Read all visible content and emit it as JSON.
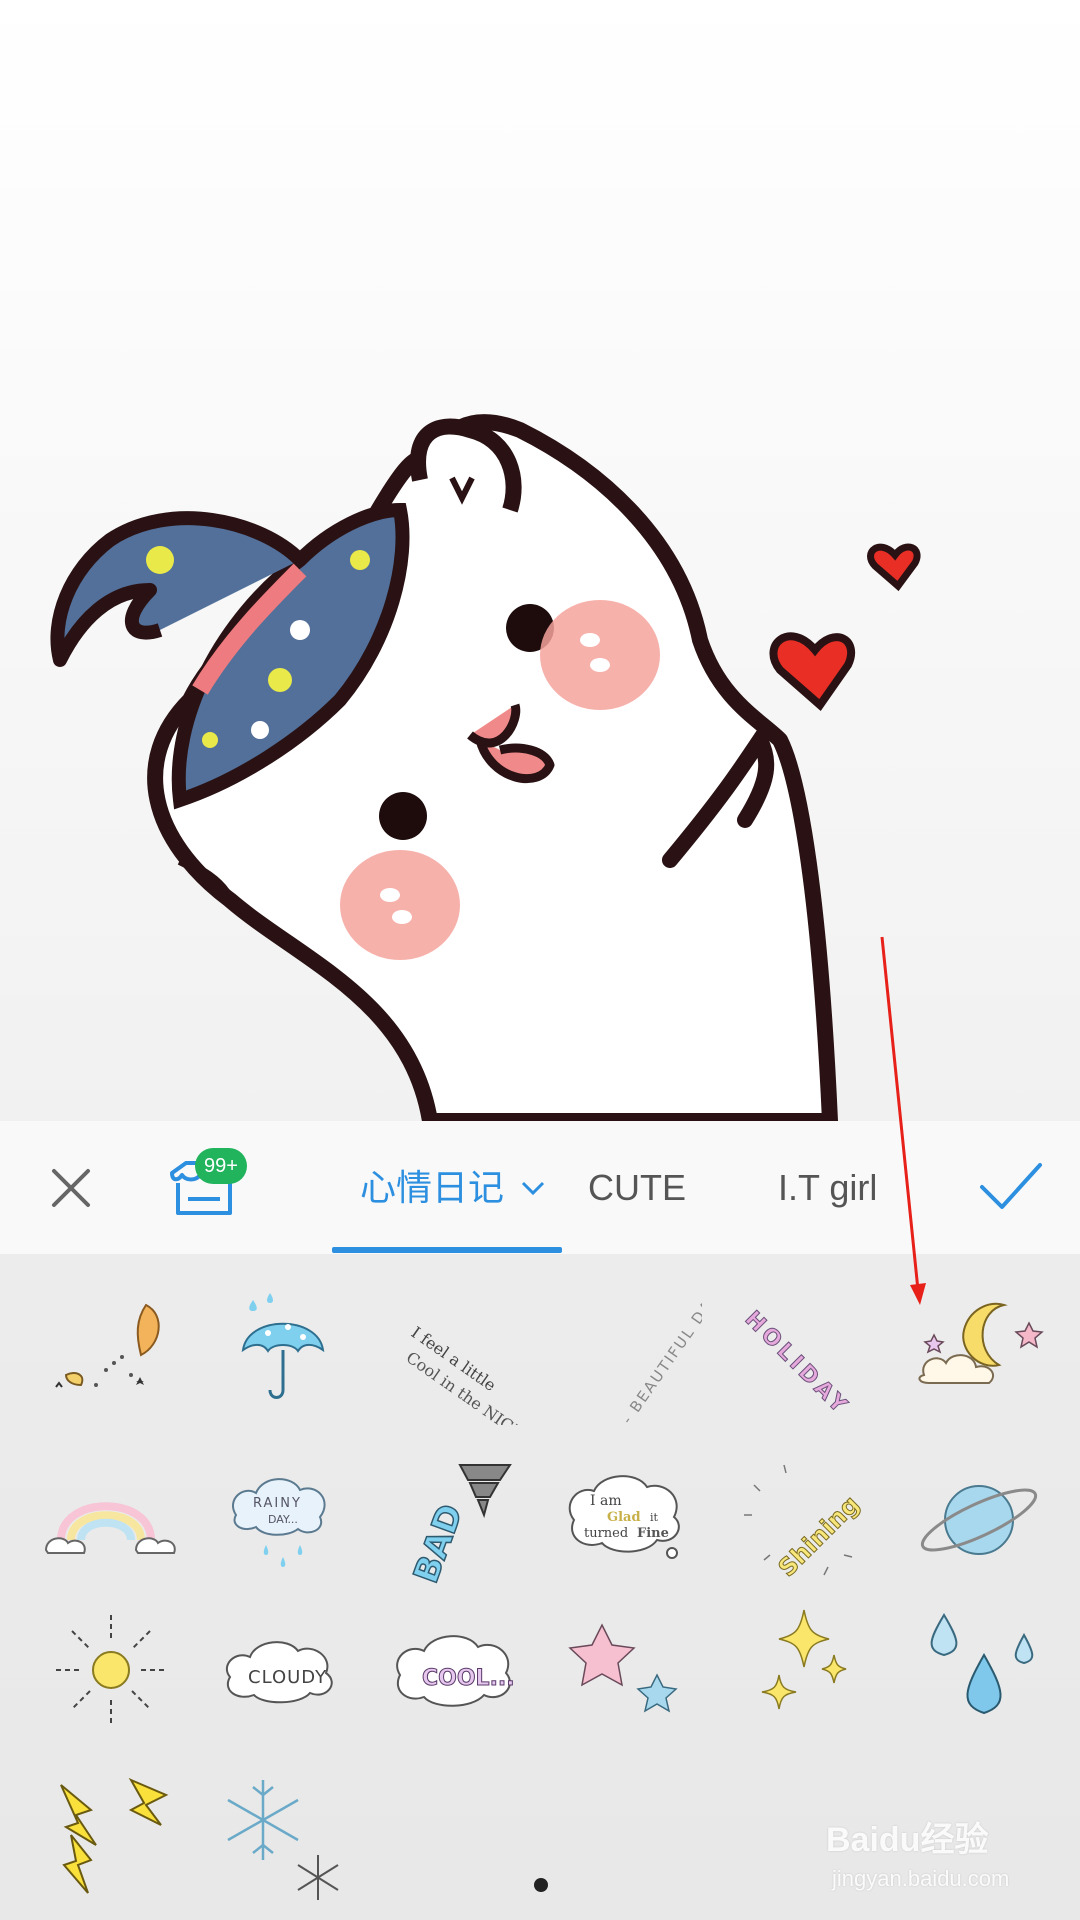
{
  "toolbar": {
    "store_badge": "99+",
    "tabs": [
      {
        "label": "心情日记",
        "active": true
      },
      {
        "label": "CUTE",
        "active": false
      },
      {
        "label": "I.T girl",
        "active": false
      }
    ]
  },
  "stickers": {
    "items": [
      {
        "icon": "leaves-sticker-icon"
      },
      {
        "icon": "umbrella-sticker-icon"
      },
      {
        "icon": "feel-little-cool-sticker-icon",
        "text": [
          "I feel a little",
          "Cool in the NIGHT."
        ]
      },
      {
        "icon": "beautiful-day-sticker-icon",
        "text": "- BEAUTIFUL DAY -"
      },
      {
        "icon": "holiday-sticker-icon",
        "text": "HOLIDAY"
      },
      {
        "icon": "moon-cloud-sticker-icon"
      },
      {
        "icon": "rainbow-sticker-icon"
      },
      {
        "icon": "rainy-day-sticker-icon",
        "text": [
          "RAINY",
          "DAY..."
        ]
      },
      {
        "icon": "bad-tornado-sticker-icon",
        "text": "BAD"
      },
      {
        "icon": "glad-cloud-sticker-icon",
        "text": [
          "I am",
          "Glad",
          "it",
          "turned",
          "Fine"
        ]
      },
      {
        "icon": "shining-sticker-icon",
        "text": "Shining"
      },
      {
        "icon": "planet-sticker-icon"
      },
      {
        "icon": "sun-sticker-icon"
      },
      {
        "icon": "cloudy-sticker-icon",
        "text": "CLOUDY"
      },
      {
        "icon": "cool-cloud-sticker-icon",
        "text": "COOL..."
      },
      {
        "icon": "stars-sticker-icon"
      },
      {
        "icon": "sparkles-sticker-icon"
      },
      {
        "icon": "raindrops-sticker-icon"
      },
      {
        "icon": "lightning-sticker-icon"
      },
      {
        "icon": "snowflake-sticker-icon"
      }
    ]
  },
  "pagination": {
    "current": 1
  },
  "watermark": {
    "brand": "Baidu经验",
    "url": "jingyan.baidu.com"
  },
  "colors": {
    "accent": "#2d8fe0",
    "badge": "#22b35d",
    "annotation_arrow": "#e8201a"
  }
}
